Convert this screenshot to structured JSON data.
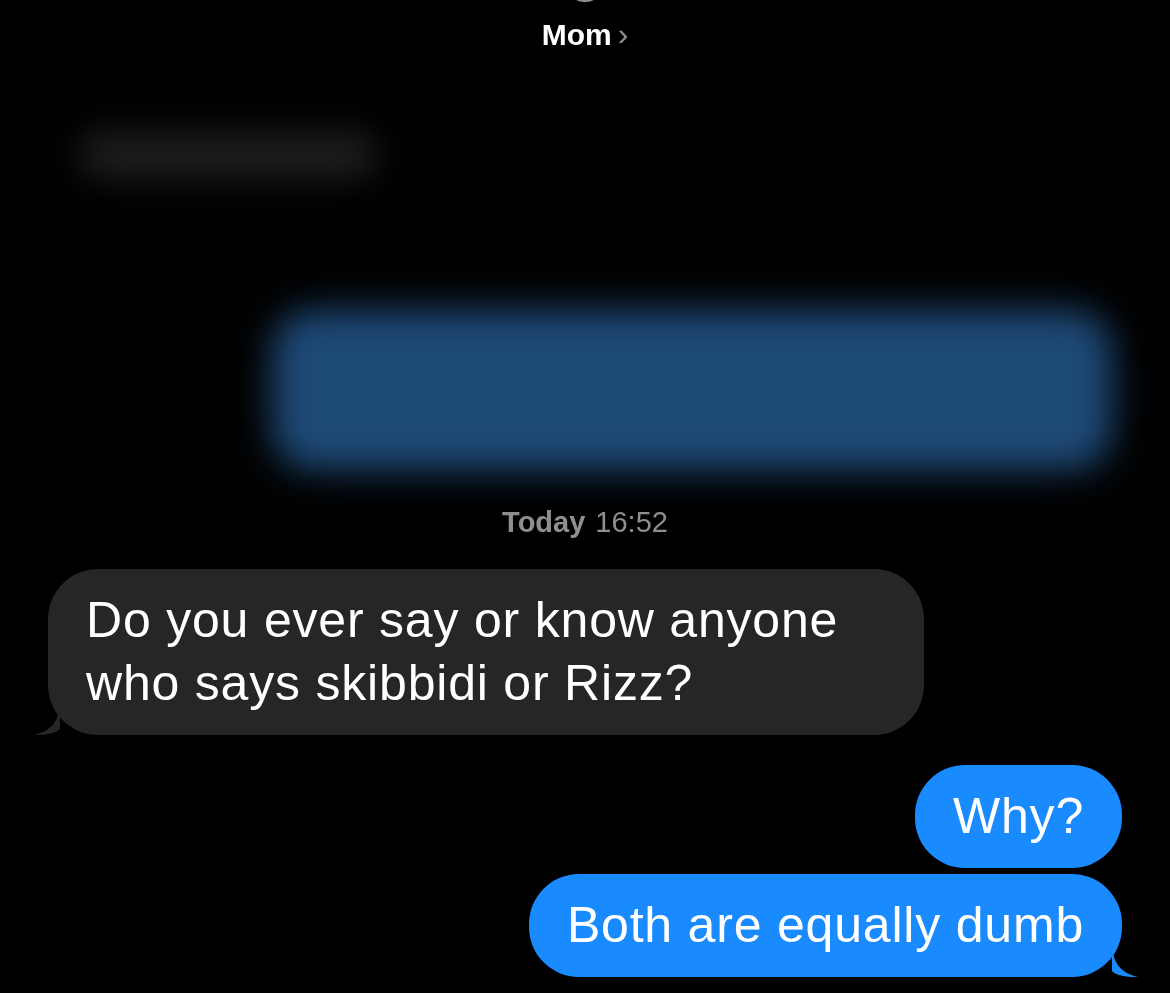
{
  "header": {
    "contact": "Mom",
    "chevron": "›"
  },
  "messages": [
    {
      "kind": "blurred",
      "from_me": false
    },
    {
      "kind": "blurred",
      "from_me": true
    },
    {
      "kind": "timestamp",
      "day": "Today",
      "time": "16:52"
    },
    {
      "kind": "text",
      "from_me": false,
      "text": "Do you ever say or know anyone who says skibbidi or Rizz?",
      "tail": true
    },
    {
      "kind": "text",
      "from_me": true,
      "text": "Why?",
      "tail": false
    },
    {
      "kind": "text",
      "from_me": true,
      "text": "Both are equally dumb",
      "tail": true
    }
  ]
}
